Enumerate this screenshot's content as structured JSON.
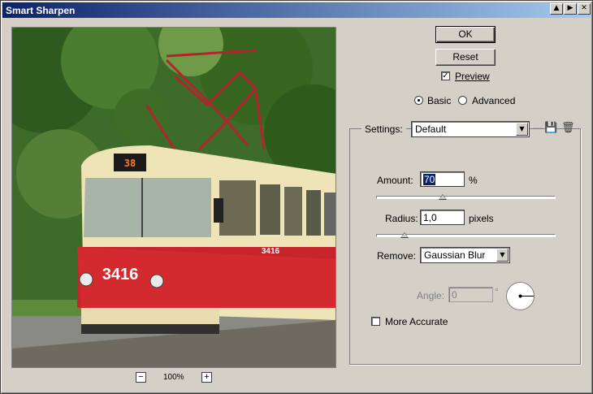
{
  "window": {
    "title": "Smart Sharpen"
  },
  "title_buttons": {
    "minimize": "▲",
    "restore": "▶",
    "close": "✕"
  },
  "preview": {
    "zoom_label": "100%",
    "zoom_out": "−",
    "zoom_in": "+"
  },
  "tram": {
    "number": "3416",
    "number_small": "3416",
    "route": "38"
  },
  "buttons": {
    "ok": "OK",
    "reset": "Reset"
  },
  "preview_option": {
    "label": "Preview",
    "checked": true
  },
  "mode": {
    "basic": "Basic",
    "advanced": "Advanced",
    "selected": "basic"
  },
  "settings": {
    "label": "Settings:",
    "value": "Default"
  },
  "amount": {
    "label": "Amount:",
    "value": "70",
    "unit": "%",
    "slider_fraction": 0.37
  },
  "radius": {
    "label": "Radius:",
    "value": "1,0",
    "unit": "pixels",
    "slider_fraction": 0.16
  },
  "remove": {
    "label": "Remove:",
    "value": "Gaussian Blur"
  },
  "angle": {
    "label": "Angle:",
    "value": "0",
    "unit": "°"
  },
  "more_accurate": {
    "label": "More Accurate",
    "checked": false
  },
  "icons": {
    "save": "save-settings-icon",
    "delete": "trash-icon"
  }
}
